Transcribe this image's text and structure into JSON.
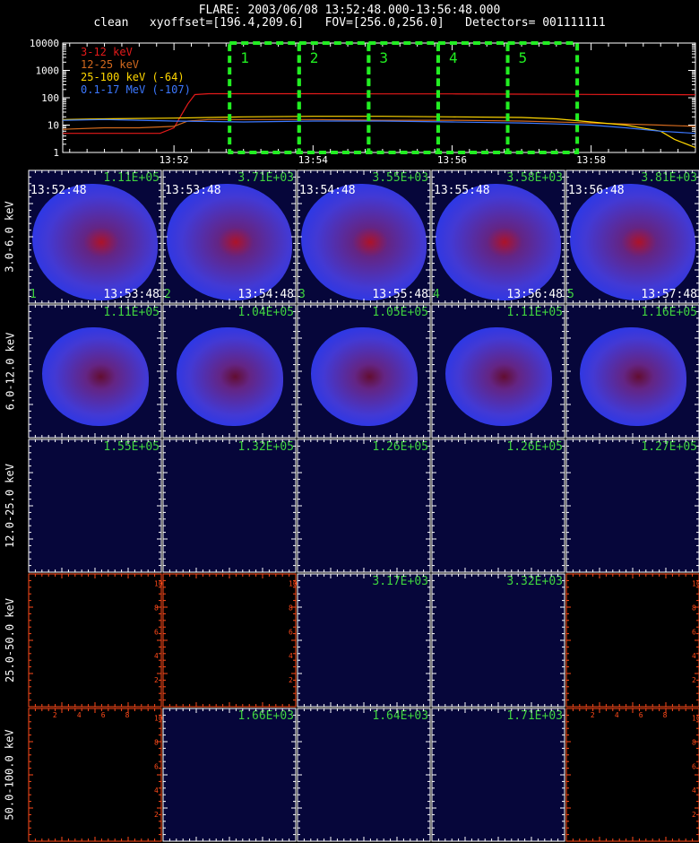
{
  "header": {
    "line1": "FLARE: 2003/06/08 13:52:48.000-13:56:48.000",
    "line2": "clean   xyoffset=[196.4,209.6]   FOV=[256.0,256.0]   Detectors= 001111111"
  },
  "chart_data": [
    {
      "type": "line",
      "title": "",
      "y_scale": "log",
      "ylim": [
        1,
        10000
      ],
      "y_tick_labels": [
        "1",
        "10",
        "100",
        "1000",
        "10000"
      ],
      "x_tick_labels": [
        "13:52",
        "13:54",
        "13:56",
        "13:58"
      ],
      "x_tick_minutes": [
        52,
        54,
        56,
        58
      ],
      "xlim_minutes": [
        50.4,
        59.5
      ],
      "series": [
        {
          "name": "3-12 keV",
          "color": "#e41a1a",
          "x": [
            50.4,
            51.0,
            51.8,
            52.0,
            52.2,
            52.3,
            52.5,
            53.0,
            54.0,
            55.0,
            56.0,
            57.0,
            58.0,
            59.0,
            59.5
          ],
          "y": [
            5,
            5,
            5,
            8,
            60,
            130,
            140,
            140,
            140,
            138,
            138,
            135,
            132,
            130,
            128
          ]
        },
        {
          "name": "12-25 keV",
          "color": "#d2691e",
          "x": [
            50.4,
            51.0,
            51.5,
            52.0,
            52.2,
            52.5,
            53.0,
            54.0,
            55.0,
            56.0,
            57.0,
            58.0,
            59.0,
            59.5
          ],
          "y": [
            7,
            8,
            8,
            9,
            14,
            16,
            16,
            16,
            15,
            15,
            14,
            12,
            10,
            9
          ]
        },
        {
          "name": "25-100 keV (-64)",
          "color": "#ffd700",
          "x": [
            50.4,
            51.0,
            52.0,
            53.0,
            54.0,
            55.0,
            56.0,
            57.0,
            57.5,
            58.0,
            58.5,
            59.0,
            59.2,
            59.5
          ],
          "y": [
            16,
            17,
            18,
            20,
            21,
            21,
            20,
            19,
            17,
            13,
            10,
            6,
            3,
            1.5
          ]
        },
        {
          "name": "0.1-17 MeV (-107)",
          "color": "#3c78ff",
          "x": [
            50.4,
            51.0,
            52.0,
            53.0,
            54.0,
            55.0,
            56.0,
            57.0,
            57.5,
            58.0,
            58.5,
            59.0,
            59.5
          ],
          "y": [
            15,
            16,
            14,
            13,
            14,
            14,
            13,
            12,
            11,
            10,
            8,
            6,
            5
          ]
        }
      ],
      "intervals": [
        {
          "label": "1",
          "start": 52.8,
          "end": 53.8
        },
        {
          "label": "2",
          "start": 53.8,
          "end": 54.8
        },
        {
          "label": "3",
          "start": 54.8,
          "end": 55.8
        },
        {
          "label": "4",
          "start": 55.8,
          "end": 56.8
        },
        {
          "label": "5",
          "start": 56.8,
          "end": 57.8
        }
      ]
    },
    {
      "type": "heatmap",
      "rows": [
        "3.0-6.0 keV",
        "6.0-12.0 keV",
        "12.0-25.0 keV",
        "25.0-50.0 keV",
        "50.0-100.0 keV"
      ],
      "columns": [
        {
          "index": "1",
          "start": "13:52:48",
          "end": "13:53:48"
        },
        {
          "index": "2",
          "start": "13:53:48",
          "end": "13:54:48"
        },
        {
          "index": "3",
          "start": "13:54:48",
          "end": "13:55:48"
        },
        {
          "index": "4",
          "start": "13:55:48",
          "end": "13:56:48"
        },
        {
          "index": "5",
          "start": "13:56:48",
          "end": "13:57:48"
        }
      ],
      "peak_values": [
        [
          "1.11E+05",
          "3.71E+03",
          "3.55E+03",
          "3.58E+03",
          "3.81E+03"
        ],
        [
          "1.11E+05",
          "1.04E+05",
          "1.05E+05",
          "1.11E+05",
          "1.16E+05"
        ],
        [
          "1.55E+05",
          "1.32E+05",
          "1.26E+05",
          "1.26E+05",
          "1.27E+05"
        ],
        [
          "",
          "",
          "3.17E+03",
          "3.32E+03",
          ""
        ],
        [
          "",
          "1.66E+03",
          "1.64E+03",
          "1.71E+03",
          ""
        ]
      ],
      "axis_tick_labels": [
        "2",
        "4",
        "6",
        "8",
        "10"
      ]
    }
  ],
  "colors": {
    "text": "#ffffff",
    "value_label": "#3fd33f",
    "interval_box": "#22ee22",
    "empty_axis": "#ff4a1a",
    "image_bg": "#06063a"
  }
}
